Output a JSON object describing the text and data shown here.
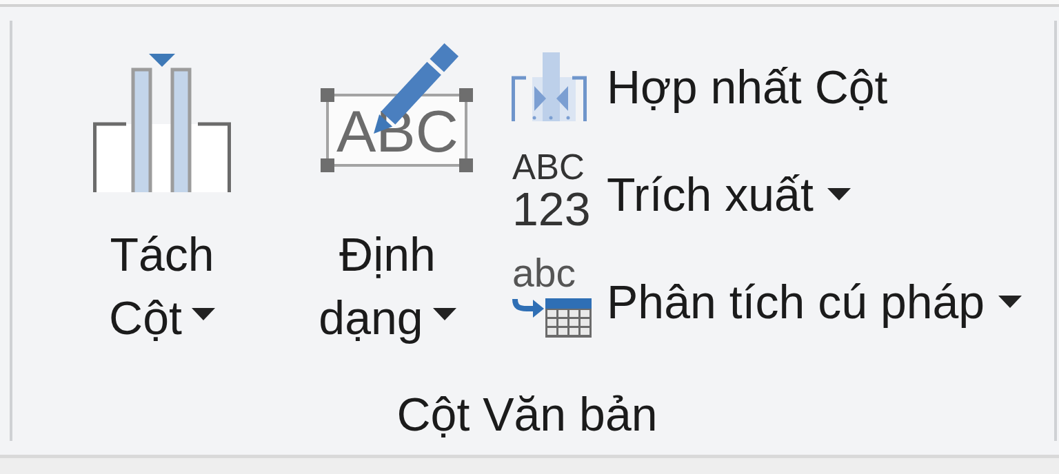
{
  "group": {
    "label": "Cột Văn bản"
  },
  "large_buttons": [
    {
      "label": "Tách Cột",
      "dropdown": true
    },
    {
      "label": "Định dạng",
      "icon_text": [
        "ABC"
      ],
      "dropdown": true
    }
  ],
  "small_buttons": [
    {
      "label": "Hợp nhất Cột",
      "dropdown": false
    },
    {
      "label": "Trích xuất",
      "icon_text": [
        "ABC",
        "123"
      ],
      "dropdown": true
    },
    {
      "label": "Phân tích cú pháp",
      "icon_text": [
        "abc"
      ],
      "dropdown": true
    }
  ]
}
